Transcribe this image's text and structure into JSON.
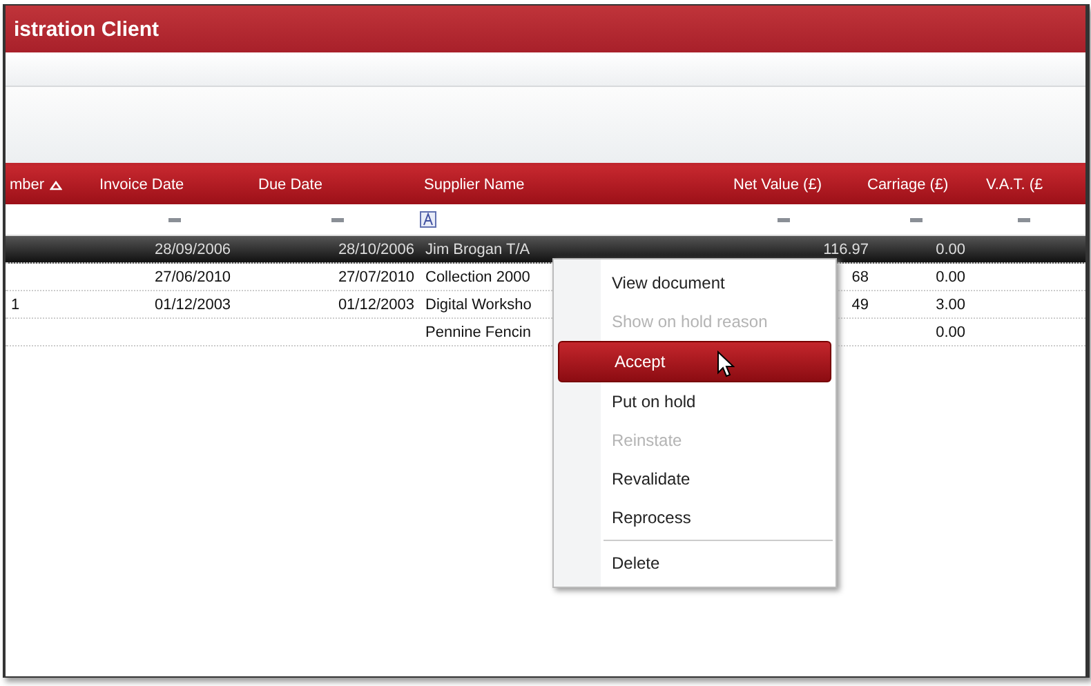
{
  "window": {
    "title": "istration Client"
  },
  "table": {
    "columns": [
      {
        "label": "mber",
        "sorted": true
      },
      {
        "label": "Invoice Date",
        "filter": {
          "kind": "dash"
        }
      },
      {
        "label": "Due Date",
        "filter": {
          "kind": "dash"
        }
      },
      {
        "label": "Supplier Name",
        "filter": {
          "kind": "text"
        }
      },
      {
        "label": "Net Value (£)",
        "filter": {
          "kind": "dash"
        }
      },
      {
        "label": "Carriage (£)",
        "filter": {
          "kind": "dash"
        }
      },
      {
        "label": "V.A.T. (£",
        "filter": {
          "kind": "dash"
        }
      }
    ],
    "rows": [
      {
        "selected": true,
        "cells": [
          "",
          "28/09/2006",
          "28/10/2006",
          "Jim Brogan T/A",
          "116.97",
          "0.00",
          ""
        ]
      },
      {
        "selected": false,
        "cells": [
          "",
          "27/06/2010",
          "27/07/2010",
          "Collection 2000",
          "68",
          "0.00",
          ""
        ]
      },
      {
        "selected": false,
        "cells": [
          "1",
          "01/12/2003",
          "01/12/2003",
          "Digital Worksho",
          "49",
          "3.00",
          ""
        ]
      },
      {
        "selected": false,
        "cells": [
          "",
          "",
          "",
          "Pennine Fencin",
          "",
          "0.00",
          ""
        ]
      }
    ]
  },
  "context_menu": {
    "items": [
      {
        "label": "View document",
        "disabled": false,
        "selected": false,
        "separator_before": false
      },
      {
        "label": "Show on hold reason",
        "disabled": true,
        "selected": false,
        "separator_before": false
      },
      {
        "label": "Accept",
        "disabled": false,
        "selected": true,
        "separator_before": false
      },
      {
        "label": "Put on hold",
        "disabled": false,
        "selected": false,
        "separator_before": false
      },
      {
        "label": "Reinstate",
        "disabled": true,
        "selected": false,
        "separator_before": false
      },
      {
        "label": "Revalidate",
        "disabled": false,
        "selected": false,
        "separator_before": false
      },
      {
        "label": "Reprocess",
        "disabled": false,
        "selected": false,
        "separator_before": false
      },
      {
        "label": "Delete",
        "disabled": false,
        "selected": false,
        "separator_before": true
      }
    ]
  }
}
